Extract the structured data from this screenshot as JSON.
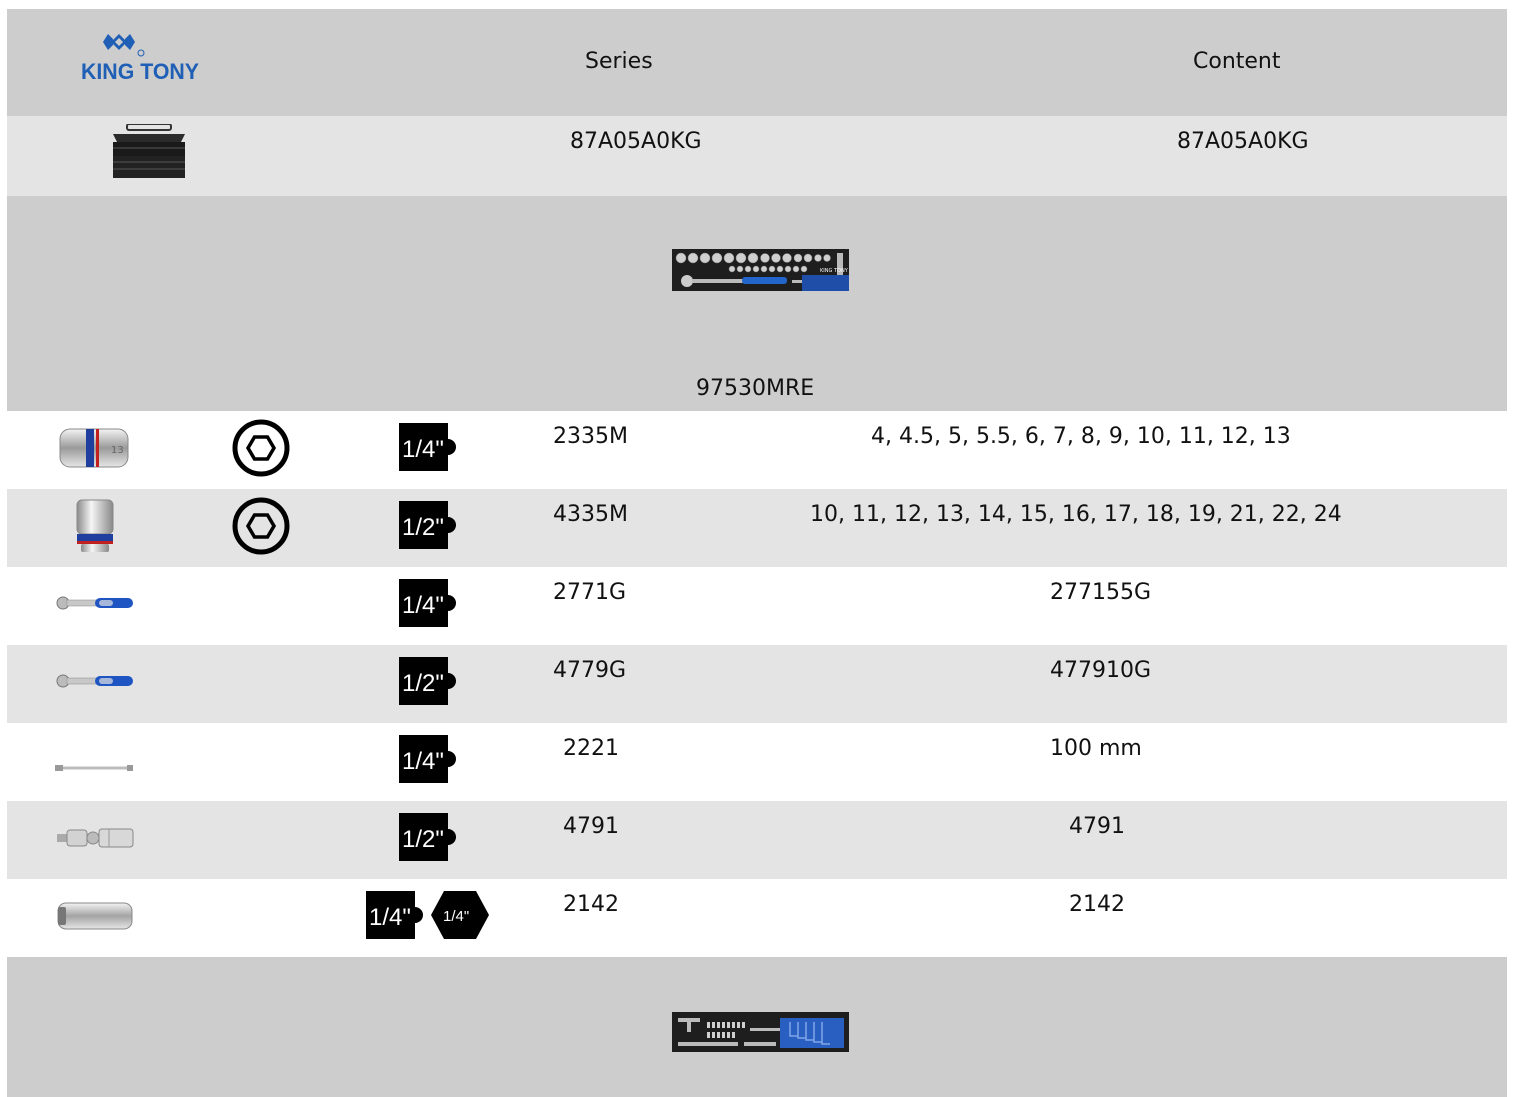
{
  "header": {
    "brand": "KING TONY",
    "series_label": "Series",
    "content_label": "Content"
  },
  "toolbox": {
    "series": "87A05A0KG",
    "content": "87A05A0KG"
  },
  "tray1": {
    "series": "97530MRE"
  },
  "rows": [
    {
      "icon": "socket-6pt-quarter-icon",
      "hex": true,
      "drive": "1/4\"",
      "series": "2335M",
      "content": "4, 4.5, 5, 5.5, 6, 7, 8, 9, 10, 11, 12, 13"
    },
    {
      "icon": "socket-6pt-half-icon",
      "hex": true,
      "drive": "1/2\"",
      "series": "4335M",
      "content": "10, 11, 12, 13, 14, 15, 16, 17, 18, 19, 21, 22, 24"
    },
    {
      "icon": "ratchet-icon",
      "hex": false,
      "drive": "1/4\"",
      "series": "2771G",
      "content": "277155G"
    },
    {
      "icon": "ratchet-icon",
      "hex": false,
      "drive": "1/2\"",
      "series": "4779G",
      "content": "477910G"
    },
    {
      "icon": "extension-bar-icon",
      "hex": false,
      "drive": "1/4\"",
      "series": "2221",
      "content": "100 mm"
    },
    {
      "icon": "universal-joint-icon",
      "hex": false,
      "drive": "1/2\"",
      "series": "4791",
      "content": "4791"
    },
    {
      "icon": "bit-adapter-icon",
      "hex": false,
      "drive": "1/4\"",
      "drive2": "1/4\"",
      "series": "2142",
      "content": "2142"
    }
  ]
}
